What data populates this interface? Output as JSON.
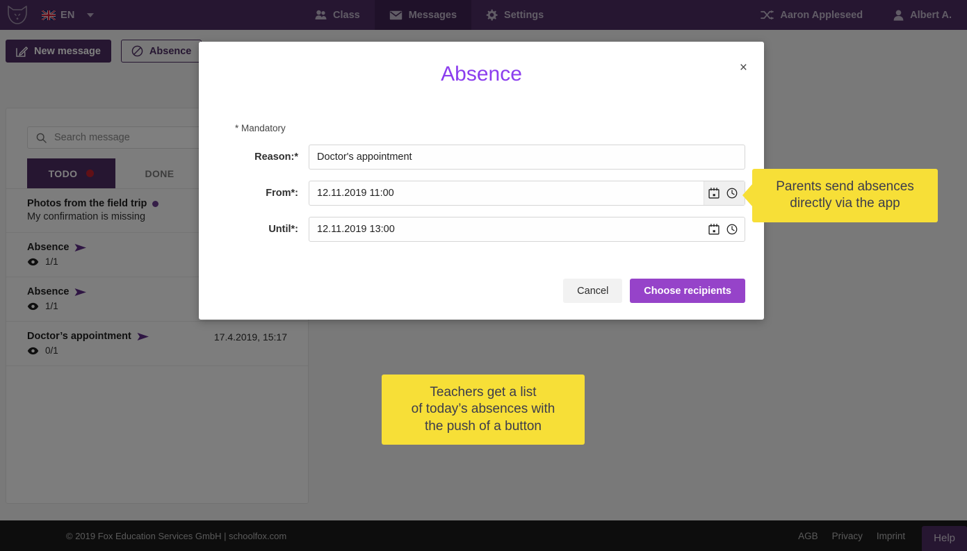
{
  "header": {
    "logo_alt": "SchoolFox fox logo",
    "language": {
      "code": "EN",
      "flag": "uk-flag"
    },
    "nav": [
      {
        "id": "class",
        "label": "Class",
        "icon": "people-icon",
        "active": false
      },
      {
        "id": "messages",
        "label": "Messages",
        "icon": "envelope-icon",
        "active": true
      },
      {
        "id": "settings",
        "label": "Settings",
        "icon": "gear-icon",
        "active": false
      }
    ],
    "nav_right": [
      {
        "id": "switch-child",
        "label": "Aaron Appleseed",
        "icon": "shuffle-icon"
      },
      {
        "id": "account",
        "label": "Albert A.",
        "icon": "person-icon"
      }
    ]
  },
  "toolbar": {
    "new_message_label": "New message",
    "absence_label": "Absence"
  },
  "sidebar": {
    "search_placeholder": "Search message",
    "tabs": [
      {
        "id": "todo",
        "label": "TODO",
        "active": true,
        "badge": true
      },
      {
        "id": "done",
        "label": "DONE",
        "active": false,
        "badge": false
      }
    ],
    "messages": [
      {
        "title": "Photos from the field trip",
        "unread_dot": true,
        "subtitle": "My confirmation is missing",
        "sent_icon": false,
        "read_count": "",
        "date": ""
      },
      {
        "title": "Absence",
        "unread_dot": false,
        "subtitle": "",
        "sent_icon": true,
        "read_count": "1/1",
        "date": ""
      },
      {
        "title": "Absence",
        "unread_dot": false,
        "subtitle": "",
        "sent_icon": true,
        "read_count": "1/1",
        "date": ""
      },
      {
        "title": "Doctor’s appointment",
        "unread_dot": false,
        "subtitle": "",
        "sent_icon": true,
        "read_count": "0/1",
        "date": "17.4.2019, 15:17"
      }
    ]
  },
  "modal": {
    "title": "Absence",
    "close_label": "×",
    "mandatory_note": "* Mandatory",
    "fields": [
      {
        "id": "reason",
        "label": "Reason:*",
        "value": "Doctor's appointment",
        "icons": []
      },
      {
        "id": "from",
        "label": "From*:",
        "value": "12.11.2019 11:00",
        "icons": [
          "calendar-icon",
          "clock-icon"
        ]
      },
      {
        "id": "until",
        "label": "Until*:",
        "value": "12.11.2019 13:00",
        "icons": [
          "calendar-icon",
          "clock-icon"
        ]
      }
    ],
    "cancel_label": "Cancel",
    "submit_label": "Choose recipients"
  },
  "callouts": [
    {
      "id": "parents",
      "lines": [
        "Parents send absences",
        "directly via the app"
      ]
    },
    {
      "id": "teachers",
      "lines": [
        "Teachers get a list",
        "of today’s absences with",
        "the push of a button"
      ]
    }
  ],
  "footer": {
    "copyright": "© 2019 Fox Education Services GmbH | schoolfox.com",
    "links": [
      "AGB",
      "Privacy",
      "Imprint"
    ],
    "help_label": "Help"
  },
  "colors": {
    "brand_purple": "#4c2c63",
    "title_purple": "#8b3dee",
    "accent_purple": "#9643c9",
    "callout_yellow": "#f7df37",
    "badge_red": "#c0202c"
  }
}
